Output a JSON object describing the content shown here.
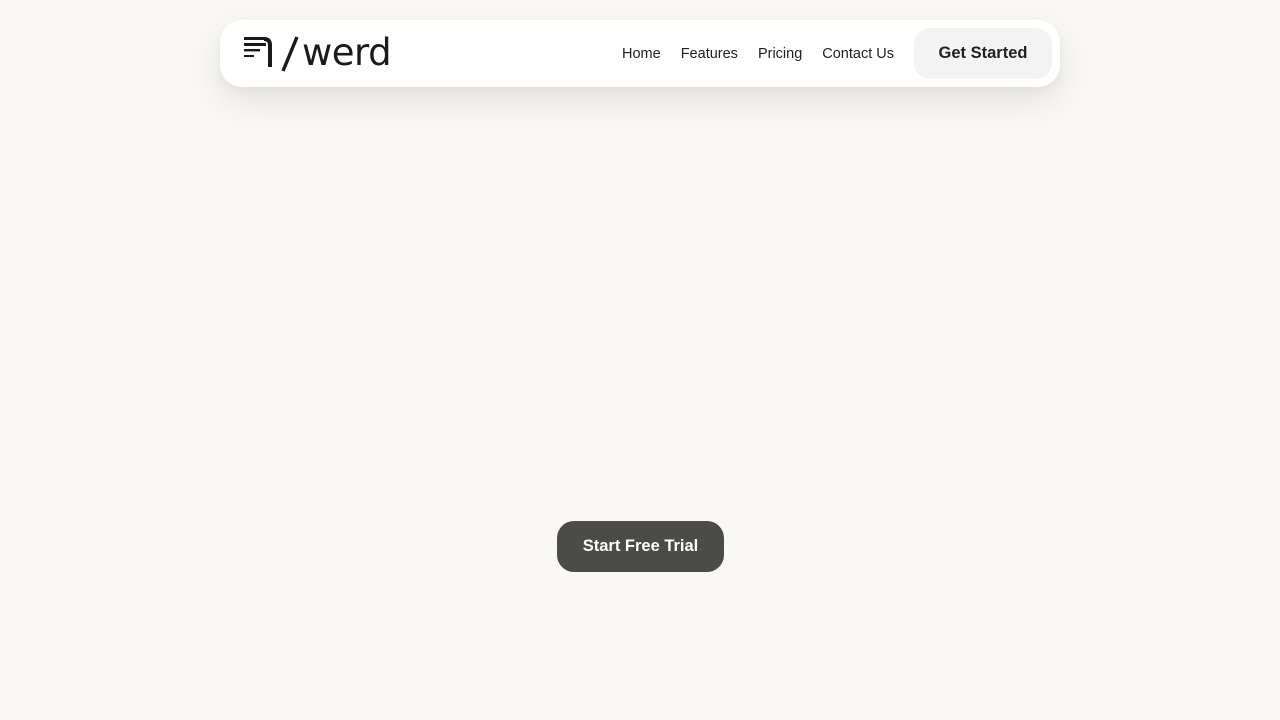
{
  "brand": {
    "name": "werd",
    "logo_icon": "document-lines-icon"
  },
  "nav": {
    "links": [
      {
        "label": "Home"
      },
      {
        "label": "Features"
      },
      {
        "label": "Pricing"
      },
      {
        "label": "Contact Us"
      }
    ],
    "cta_label": "Get Started"
  },
  "hero": {
    "cta_label": "Start Free Trial"
  },
  "colors": {
    "page_background": "#f9f8f4",
    "navbar_background": "#ffffff",
    "nav_cta_background": "#f3f3f3",
    "hero_cta_background": "#4b4b4a",
    "text_primary": "#1a1a1a"
  }
}
